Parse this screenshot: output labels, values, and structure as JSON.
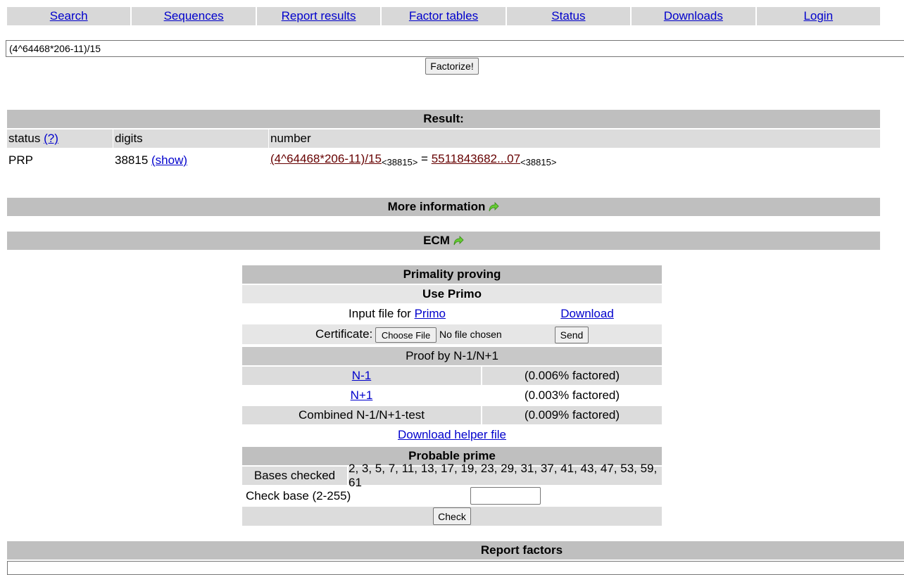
{
  "nav": {
    "items": [
      {
        "label": "Search"
      },
      {
        "label": "Sequences"
      },
      {
        "label": "Report results"
      },
      {
        "label": "Factor tables"
      },
      {
        "label": "Status"
      },
      {
        "label": "Downloads"
      },
      {
        "label": "Login"
      }
    ]
  },
  "query": {
    "value": "(4^64468*206-11)/15",
    "button_label": "Factorize!"
  },
  "result": {
    "header": "Result:",
    "col_status": "status",
    "col_status_help": "(?)",
    "col_digits": "digits",
    "col_number": "number",
    "status": "PRP",
    "digits": "38815",
    "show_label": "(show)",
    "expression": "(4^64468*206-11)/15",
    "expression_digits": "<38815>",
    "equals": "=",
    "value": "5511843682...07",
    "value_digits": "<38815>"
  },
  "more_info": {
    "label": "More information"
  },
  "ecm": {
    "label": "ECM"
  },
  "primality": {
    "header": "Primality proving",
    "use_primo": "Use Primo",
    "input_file_text": "Input file for",
    "primo_link": "Primo",
    "download_link": "Download",
    "certificate_label": "Certificate:",
    "choose_file_label": "Choose File",
    "no_file_text": "No file chosen",
    "send_label": "Send",
    "proof_header": "Proof by N-1/N+1",
    "rows": [
      {
        "label": "N-1",
        "value": "(0.006% factored)"
      },
      {
        "label": "N+1",
        "value": "(0.003% factored)"
      },
      {
        "label": "Combined N-1/N+1-test",
        "value": "(0.009% factored)"
      }
    ],
    "helper_link": "Download helper file",
    "probable_header": "Probable prime",
    "bases_label": "Bases checked",
    "bases_value": "2, 3, 5, 7, 11, 13, 17, 19, 23, 29, 31, 37, 41, 43, 47, 53, 59, 61",
    "check_base_label": "Check base (2-255)",
    "check_base_value": "",
    "check_label": "Check"
  },
  "report": {
    "header": "Report factors"
  },
  "icons": {
    "more_info_icon": "green-arrow-icon",
    "ecm_icon": "green-arrow-icon"
  }
}
